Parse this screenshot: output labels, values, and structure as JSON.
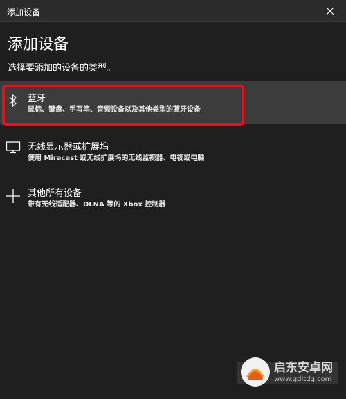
{
  "window": {
    "title": "添加设备"
  },
  "page": {
    "heading": "添加设备",
    "subheading": "选择要添加的设备的类型。"
  },
  "options": [
    {
      "name": "蓝牙",
      "description": "鼠标、键盘、手写笔、音频设备以及其他类型的蓝牙设备",
      "icon": "bluetooth-icon",
      "selected": true
    },
    {
      "name": "无线显示器或扩展坞",
      "description": "使用 Miracast 或无线扩展坞的无线监视器、电视或电脑",
      "icon": "monitor-icon",
      "selected": false
    },
    {
      "name": "其他所有设备",
      "description": "带有无线适配器、DLNA 等的 Xbox 控制器",
      "icon": "plus-icon",
      "selected": false
    }
  ],
  "annotation": {
    "highlight_color": "#e0131f"
  },
  "watermark": {
    "text": "启东安卓网",
    "url": "www.qdltdq.com"
  },
  "colors": {
    "background": "#1f1f1f",
    "selected_row": "#3c3c3c"
  }
}
